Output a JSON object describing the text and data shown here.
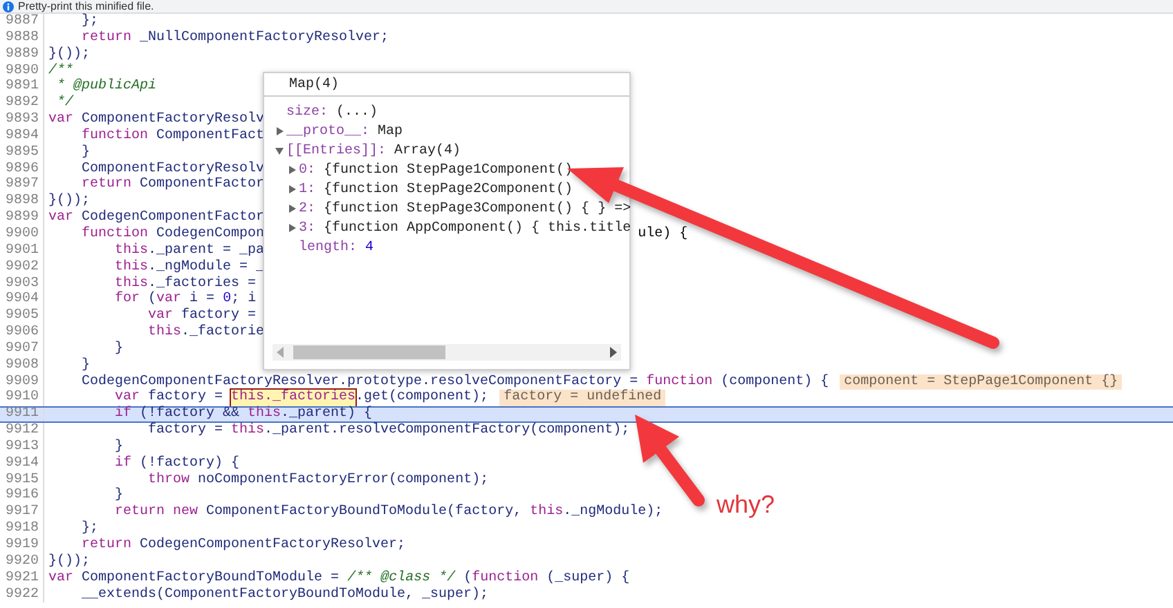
{
  "banner": {
    "text": "Pretty-print this minified file."
  },
  "editor": {
    "lines": [
      {
        "number": "9887",
        "current": false,
        "segments": [
          {
            "kind": "code",
            "text": "    };"
          }
        ]
      },
      {
        "number": "9888",
        "current": false,
        "segments": [
          {
            "kind": "kw",
            "text": "    return"
          },
          {
            "kind": "code",
            "text": " _NullComponentFactoryResolver;"
          }
        ]
      },
      {
        "number": "9889",
        "current": false,
        "segments": [
          {
            "kind": "code",
            "text": "}());"
          }
        ]
      },
      {
        "number": "9890",
        "current": false,
        "segments": [
          {
            "kind": "com",
            "text": "/**"
          }
        ]
      },
      {
        "number": "9891",
        "current": false,
        "segments": [
          {
            "kind": "com",
            "text": " * @publicApi"
          }
        ]
      },
      {
        "number": "9892",
        "current": false,
        "segments": [
          {
            "kind": "com",
            "text": " */"
          }
        ]
      },
      {
        "number": "9893",
        "current": false,
        "segments": [
          {
            "kind": "kw",
            "text": "var"
          },
          {
            "kind": "code",
            "text": " ComponentFactoryResolv"
          }
        ]
      },
      {
        "number": "9894",
        "current": false,
        "segments": [
          {
            "kind": "kw",
            "text": "    function"
          },
          {
            "kind": "code",
            "text": " ComponentFact"
          }
        ]
      },
      {
        "number": "9895",
        "current": false,
        "segments": [
          {
            "kind": "code",
            "text": "    }"
          }
        ]
      },
      {
        "number": "9896",
        "current": false,
        "segments": [
          {
            "kind": "code",
            "text": "    ComponentFactoryResolv"
          }
        ]
      },
      {
        "number": "9897",
        "current": false,
        "segments": [
          {
            "kind": "kw",
            "text": "    return"
          },
          {
            "kind": "code",
            "text": " ComponentFactor"
          }
        ]
      },
      {
        "number": "9898",
        "current": false,
        "segments": [
          {
            "kind": "code",
            "text": "}());"
          }
        ]
      },
      {
        "number": "9899",
        "current": false,
        "segments": [
          {
            "kind": "kw",
            "text": "var"
          },
          {
            "kind": "code",
            "text": " CodegenComponentFactor"
          }
        ]
      },
      {
        "number": "9900",
        "current": false,
        "segments": [
          {
            "kind": "kw",
            "text": "    function"
          },
          {
            "kind": "code",
            "text": " CodegenCompon"
          }
        ],
        "tail": "ule) {"
      },
      {
        "number": "9901",
        "current": false,
        "segments": [
          {
            "kind": "kw",
            "text": "        this"
          },
          {
            "kind": "code",
            "text": "._parent = _pa"
          }
        ]
      },
      {
        "number": "9902",
        "current": false,
        "segments": [
          {
            "kind": "kw",
            "text": "        this"
          },
          {
            "kind": "code",
            "text": "._ngModule = _"
          }
        ]
      },
      {
        "number": "9903",
        "current": false,
        "segments": [
          {
            "kind": "kw",
            "text": "        this"
          },
          {
            "kind": "code",
            "text": "._factories ="
          }
        ]
      },
      {
        "number": "9904",
        "current": false,
        "segments": [
          {
            "kind": "kw",
            "text": "        for"
          },
          {
            "kind": "code",
            "text": " ("
          },
          {
            "kind": "kw",
            "text": "var"
          },
          {
            "kind": "code",
            "text": " i = "
          },
          {
            "kind": "num",
            "text": "0"
          },
          {
            "kind": "code",
            "text": "; i"
          }
        ]
      },
      {
        "number": "9905",
        "current": false,
        "segments": [
          {
            "kind": "kw",
            "text": "            var"
          },
          {
            "kind": "code",
            "text": " factory ="
          }
        ]
      },
      {
        "number": "9906",
        "current": false,
        "segments": [
          {
            "kind": "kw",
            "text": "            this"
          },
          {
            "kind": "code",
            "text": "._factorie"
          }
        ]
      },
      {
        "number": "9907",
        "current": false,
        "segments": [
          {
            "kind": "code",
            "text": "        }"
          }
        ]
      },
      {
        "number": "9908",
        "current": false,
        "segments": [
          {
            "kind": "code",
            "text": "    }"
          }
        ]
      },
      {
        "number": "9909",
        "current": false,
        "segments": [
          {
            "kind": "code",
            "text": "    CodegenComponentFactoryResolver.prototype.resolveComponentFactory = "
          },
          {
            "kind": "kw",
            "text": "function"
          },
          {
            "kind": "code",
            "text": " (component) {"
          }
        ],
        "inline_value": "component = StepPage1Component {}"
      },
      {
        "number": "9910",
        "current": false,
        "segments": [
          {
            "kind": "kw",
            "text": "        var"
          },
          {
            "kind": "code",
            "text": " factory = "
          },
          {
            "kind": "hl",
            "text": "this._factories"
          },
          {
            "kind": "code",
            "text": ".get(component);"
          }
        ],
        "inline_value": "factory = undefined"
      },
      {
        "number": "9911",
        "current": true,
        "segments": [
          {
            "kind": "kw",
            "text": "        if"
          },
          {
            "kind": "code",
            "text": " (!factory && "
          },
          {
            "kind": "kw",
            "text": "this"
          },
          {
            "kind": "code",
            "text": "._parent) {"
          }
        ]
      },
      {
        "number": "9912",
        "current": false,
        "segments": [
          {
            "kind": "code",
            "text": "            factory = "
          },
          {
            "kind": "kw",
            "text": "this"
          },
          {
            "kind": "code",
            "text": "._parent.resolveComponentFactory(component);"
          }
        ]
      },
      {
        "number": "9913",
        "current": false,
        "segments": [
          {
            "kind": "code",
            "text": "        }"
          }
        ]
      },
      {
        "number": "9914",
        "current": false,
        "segments": [
          {
            "kind": "kw",
            "text": "        if"
          },
          {
            "kind": "code",
            "text": " (!factory) {"
          }
        ]
      },
      {
        "number": "9915",
        "current": false,
        "segments": [
          {
            "kind": "kw",
            "text": "            throw"
          },
          {
            "kind": "code",
            "text": " noComponentFactoryError(component);"
          }
        ]
      },
      {
        "number": "9916",
        "current": false,
        "segments": [
          {
            "kind": "code",
            "text": "        }"
          }
        ]
      },
      {
        "number": "9917",
        "current": false,
        "segments": [
          {
            "kind": "kw",
            "text": "        return new"
          },
          {
            "kind": "code",
            "text": " ComponentFactoryBoundToModule(factory, "
          },
          {
            "kind": "kw",
            "text": "this"
          },
          {
            "kind": "code",
            "text": "._ngModule);"
          }
        ]
      },
      {
        "number": "9918",
        "current": false,
        "segments": [
          {
            "kind": "code",
            "text": "    };"
          }
        ]
      },
      {
        "number": "9919",
        "current": false,
        "segments": [
          {
            "kind": "kw",
            "text": "    return"
          },
          {
            "kind": "code",
            "text": " CodegenComponentFactoryResolver;"
          }
        ]
      },
      {
        "number": "9920",
        "current": false,
        "segments": [
          {
            "kind": "code",
            "text": "}());"
          }
        ]
      },
      {
        "number": "9921",
        "current": false,
        "segments": [
          {
            "kind": "kw",
            "text": "var"
          },
          {
            "kind": "code",
            "text": " ComponentFactoryBoundToModule = "
          },
          {
            "kind": "com",
            "text": "/** @class */"
          },
          {
            "kind": "code",
            "text": " ("
          },
          {
            "kind": "kw",
            "text": "function"
          },
          {
            "kind": "code",
            "text": " (_super) {"
          }
        ]
      },
      {
        "number": "9922",
        "current": false,
        "segments": [
          {
            "kind": "code",
            "text": "    __extends(ComponentFactoryBoundToModule, _super);"
          }
        ]
      }
    ]
  },
  "popup": {
    "title": "Map(4)",
    "rows": [
      {
        "kind": "leaf",
        "key": "size:",
        "value": "(...)"
      },
      {
        "kind": "node",
        "key": "__proto__:",
        "value": "Map",
        "expanded": false
      },
      {
        "kind": "node",
        "key": "[[Entries]]:",
        "value": "Array(4)",
        "expanded": true,
        "children": [
          {
            "kind": "node",
            "key": "0:",
            "value": "{function StepPage1Component()",
            "expanded": false
          },
          {
            "kind": "node",
            "key": "1:",
            "value": "{function StepPage2Component()",
            "expanded": false
          },
          {
            "kind": "node",
            "key": "2:",
            "value": "{function StepPage3Component() { } =>",
            "expanded": false
          },
          {
            "kind": "node",
            "key": "3:",
            "value": "{function AppComponent() { this.title",
            "expanded": false
          },
          {
            "kind": "leaf",
            "key": "length:",
            "value": "4"
          }
        ]
      }
    ]
  },
  "note": {
    "text": "why?"
  }
}
